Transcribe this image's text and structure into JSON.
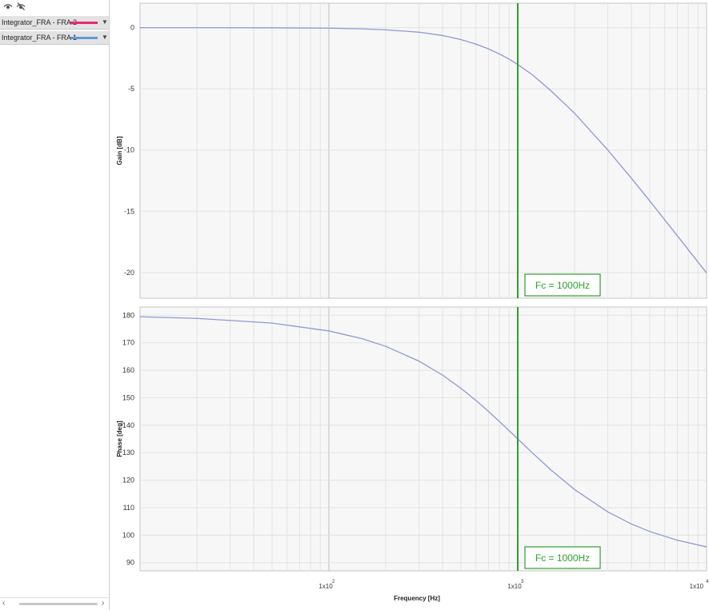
{
  "sidebar": {
    "traces": [
      {
        "label": "Integrator_FRA - FRA 2",
        "color": "#e8287a"
      },
      {
        "label": "Integrator_FRA - FRA 1",
        "color": "#5b9bd5"
      }
    ]
  },
  "chart_data": [
    {
      "type": "line",
      "xscale": "log",
      "xlim": [
        10,
        10000
      ],
      "ylabel": "Gain [dB]",
      "ylim": [
        -22.1,
        2
      ],
      "yticks": [
        0,
        -5,
        -10,
        -15,
        -20
      ],
      "ytick_labels": [
        "0",
        "-5",
        "-10",
        "-15",
        "-20"
      ],
      "grid": true,
      "series": [
        {
          "color": "#8f97d6",
          "x": [
            10,
            20,
            50,
            100,
            150,
            200,
            300,
            400,
            500,
            600,
            700,
            800,
            900,
            1000,
            1200,
            1500,
            2000,
            3000,
            4000,
            5000,
            7000,
            10000
          ],
          "y": [
            0,
            -0.002,
            -0.011,
            -0.04,
            -0.1,
            -0.17,
            -0.37,
            -0.64,
            -0.97,
            -1.34,
            -1.73,
            -2.15,
            -2.57,
            -3.01,
            -3.87,
            -5.16,
            -6.99,
            -10.0,
            -12.3,
            -14.15,
            -17.0,
            -20.04
          ]
        }
      ],
      "marker": {
        "x": 1000,
        "label": "Fc = 1000Hz",
        "color": "#2e9e2e"
      }
    },
    {
      "type": "line",
      "xscale": "log",
      "xlim": [
        10,
        10000
      ],
      "xlabel": "Frequency [Hz]",
      "xticks": [
        100,
        1000,
        10000
      ],
      "xtick_labels": [
        {
          "base": "1x10",
          "exp": "2"
        },
        {
          "base": "1x10",
          "exp": "3"
        },
        {
          "base": "1x10",
          "exp": "4"
        }
      ],
      "ylabel": "Phase [deg]",
      "ylim": [
        87,
        183
      ],
      "yticks": [
        180,
        170,
        160,
        150,
        140,
        130,
        120,
        110,
        100,
        90
      ],
      "ytick_labels": [
        "180",
        "170",
        "160",
        "150",
        "140",
        "130",
        "120",
        "110",
        "100",
        "90"
      ],
      "grid": true,
      "series": [
        {
          "color": "#8f97d6",
          "x": [
            10,
            20,
            50,
            100,
            150,
            200,
            300,
            400,
            500,
            600,
            700,
            800,
            900,
            1000,
            1200,
            1500,
            2000,
            3000,
            4000,
            5000,
            7000,
            10000
          ],
          "y": [
            179.43,
            178.85,
            177.14,
            174.29,
            171.47,
            168.69,
            163.3,
            158.2,
            153.43,
            149.04,
            145.01,
            141.34,
            138.01,
            135.0,
            129.81,
            123.69,
            116.57,
            108.43,
            104.04,
            101.31,
            98.13,
            95.71
          ]
        }
      ],
      "marker": {
        "x": 1000,
        "label": "Fc = 1000Hz",
        "color": "#2e9e2e"
      }
    }
  ]
}
